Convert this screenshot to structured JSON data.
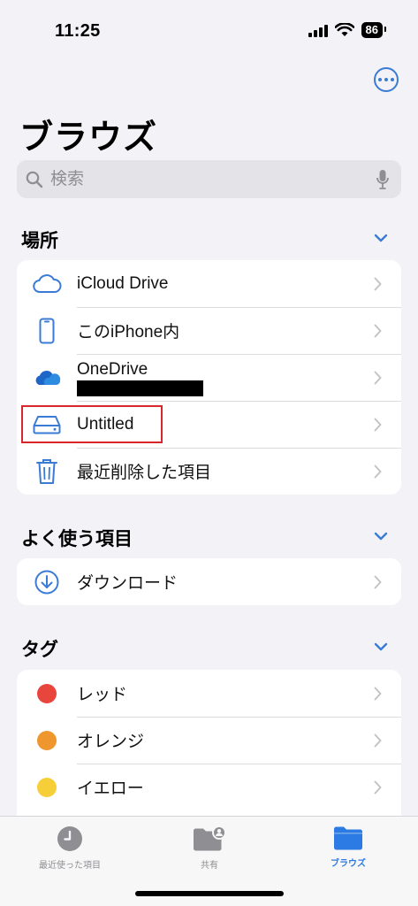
{
  "status": {
    "time": "11:25",
    "battery": "86"
  },
  "title": "ブラウズ",
  "search": {
    "placeholder": "検索"
  },
  "locations": {
    "header": "場所",
    "items": [
      {
        "label": "iCloud Drive",
        "icon": "icloud-icon"
      },
      {
        "label": "このiPhone内",
        "icon": "iphone-icon"
      },
      {
        "label": "OneDrive",
        "icon": "onedrive-icon"
      },
      {
        "label": "Untitled",
        "icon": "drive-icon"
      },
      {
        "label": "最近削除した項目",
        "icon": "trash-icon"
      }
    ]
  },
  "favorites": {
    "header": "よく使う項目",
    "items": [
      {
        "label": "ダウンロード",
        "icon": "download-icon"
      }
    ]
  },
  "tags": {
    "header": "タグ",
    "items": [
      {
        "label": "レッド",
        "color": "#e8453c"
      },
      {
        "label": "オレンジ",
        "color": "#f0962e"
      },
      {
        "label": "イエロー",
        "color": "#f6cf38"
      }
    ]
  },
  "tabbar": {
    "recents": "最近使った項目",
    "shared": "共有",
    "browse": "ブラウズ"
  },
  "colors": {
    "accent": "#3a7bd5",
    "highlight": "#d8262c"
  }
}
